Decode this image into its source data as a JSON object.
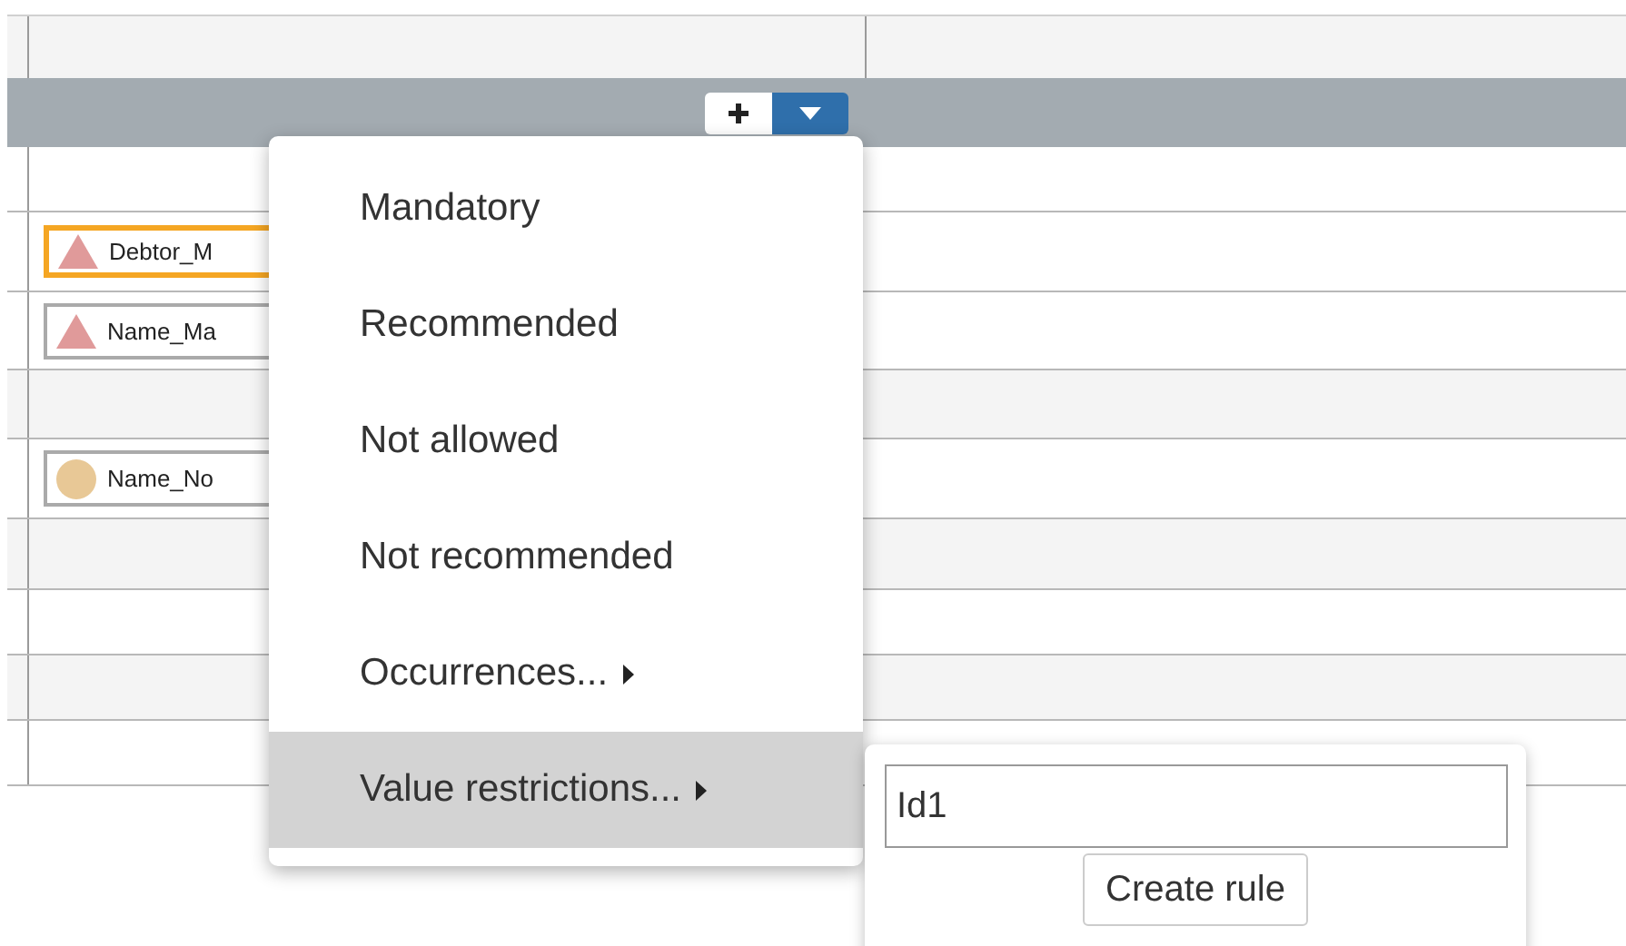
{
  "rows": [
    {},
    {
      "chip": {
        "kind": "triangle",
        "label": "Debtor_M",
        "selected": true
      }
    },
    {
      "chip": {
        "kind": "triangle",
        "label": "Name_Ma",
        "selected": false
      }
    },
    {},
    {
      "chip": {
        "kind": "circle",
        "label": "Name_No",
        "selected": false
      }
    },
    {},
    {},
    {},
    {}
  ],
  "menu": {
    "items": [
      {
        "label": "Mandatory",
        "selected": false,
        "submenu": false
      },
      {
        "label": "Recommended",
        "selected": false,
        "submenu": false
      },
      {
        "label": "Not allowed",
        "selected": false,
        "submenu": false
      },
      {
        "label": "Not recommended",
        "selected": false,
        "submenu": false
      },
      {
        "label": "Occurrences...",
        "selected": false,
        "submenu": true
      },
      {
        "label": "Value restrictions...",
        "selected": true,
        "submenu": true
      }
    ]
  },
  "submenu": {
    "value": "Id1",
    "button": "Create rule"
  }
}
